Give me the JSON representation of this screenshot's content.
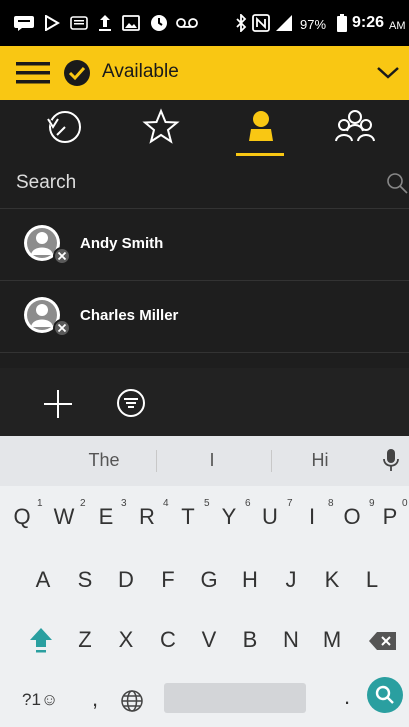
{
  "status_bar": {
    "battery": "97%",
    "time": "9:26",
    "ampm": "AM"
  },
  "header": {
    "status_label": "Available",
    "accent": "#f9c713"
  },
  "tabs": [
    {
      "icon": "history-icon"
    },
    {
      "icon": "star-icon"
    },
    {
      "icon": "contact-icon",
      "selected": true
    },
    {
      "icon": "group-icon"
    }
  ],
  "search": {
    "placeholder": "Search"
  },
  "contacts": [
    {
      "name": "Andy Smith"
    },
    {
      "name": "Charles Miller"
    }
  ],
  "keyboard": {
    "suggestions": [
      "The",
      "I",
      "Hi"
    ],
    "row1": [
      "Q",
      "W",
      "E",
      "R",
      "T",
      "Y",
      "U",
      "I",
      "O",
      "P"
    ],
    "row1_nums": [
      "1",
      "2",
      "3",
      "4",
      "5",
      "6",
      "7",
      "8",
      "9",
      "0"
    ],
    "row2": [
      "A",
      "S",
      "D",
      "F",
      "G",
      "H",
      "J",
      "K",
      "L"
    ],
    "row3": [
      "Z",
      "X",
      "C",
      "V",
      "B",
      "N",
      "M"
    ],
    "symbols_label": "?1☺",
    "comma": ",",
    "period": "."
  }
}
